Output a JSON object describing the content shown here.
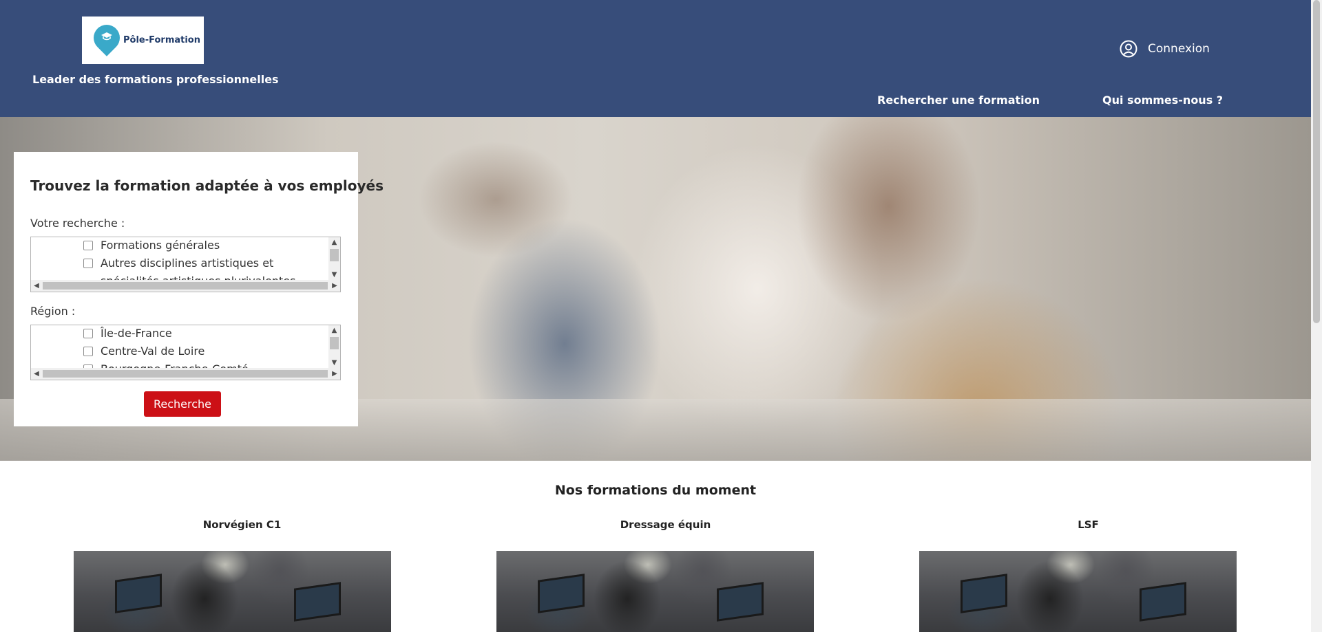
{
  "header": {
    "logo_text": "Pôle-Formation",
    "tagline": "Leader des formations professionnelles",
    "login_label": "Connexion",
    "nav": [
      {
        "label": "Rechercher une formation"
      },
      {
        "label": "Qui sommes-nous ?"
      }
    ],
    "background_color": "#374d7a"
  },
  "search_panel": {
    "title": "Trouvez la formation adaptée à vos employés",
    "query_label": "Votre recherche :",
    "query_options": [
      {
        "label": "Formations générales",
        "checked": false
      },
      {
        "label": "Autres disciplines artistiques et",
        "checked": false
      }
    ],
    "query_partial_line": "spécialités artistiques plurivalentes",
    "region_label": "Région :",
    "region_options": [
      {
        "label": "Île-de-France",
        "checked": false
      },
      {
        "label": "Centre-Val de Loire",
        "checked": false
      }
    ],
    "region_partial_line": "Bourgogne-Franche-Comté",
    "submit_label": "Recherche",
    "submit_color": "#cc1016"
  },
  "featured": {
    "title": "Nos formations du moment",
    "courses": [
      {
        "title": "Norvégien C1"
      },
      {
        "title": "Dressage équin"
      },
      {
        "title": "LSF"
      }
    ]
  },
  "icons": {
    "login": "user-circle-icon",
    "logo": "map-pin-graduation-cap-icon"
  }
}
